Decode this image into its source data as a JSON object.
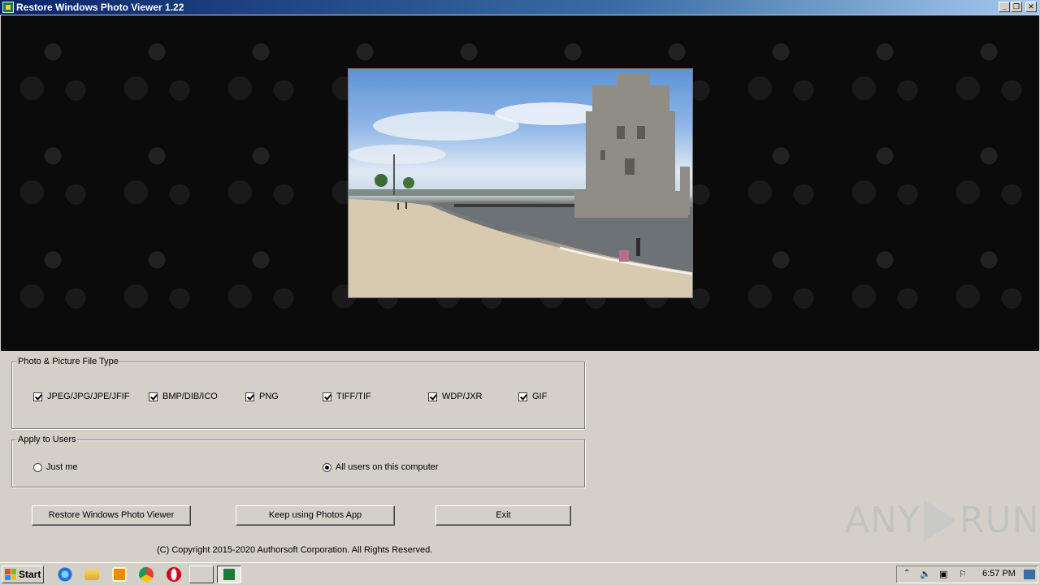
{
  "window": {
    "title": "Restore Windows Photo Viewer 1.22",
    "controls": {
      "minimize": "_",
      "restore": "❐",
      "close": "✕"
    }
  },
  "file_types": {
    "legend": "Photo & Picture File Type",
    "items": [
      {
        "label": "JPEG/JPG/JPE/JFIF",
        "checked": true
      },
      {
        "label": "BMP/DIB/ICO",
        "checked": true
      },
      {
        "label": "PNG",
        "checked": true
      },
      {
        "label": "TIFF/TIF",
        "checked": true
      },
      {
        "label": "WDP/JXR",
        "checked": true
      },
      {
        "label": "GIF",
        "checked": true
      }
    ]
  },
  "users": {
    "legend": "Apply to Users",
    "options": [
      {
        "label": "Just me",
        "selected": false
      },
      {
        "label": "All users on this computer",
        "selected": true
      }
    ]
  },
  "buttons": {
    "restore": "Restore Windows Photo Viewer",
    "keep": "Keep using Photos App",
    "exit": "Exit"
  },
  "copyright": "(C) Copyright 2015-2020 Authorsoft Corporation. All Rights Reserved.",
  "watermark": {
    "left": "ANY",
    "right": "RUN"
  },
  "taskbar": {
    "start_label": "Start",
    "clock": "6:57 PM",
    "quick_launch_icons": [
      "ie-icon",
      "explorer-icon",
      "media-player-icon",
      "chrome-icon",
      "opera-icon"
    ],
    "tray_icons": [
      "chevron-up-icon",
      "volume-icon",
      "network-icon",
      "flag-icon",
      "show-desktop-icon"
    ]
  },
  "colors": {
    "title_start": "#0a246a",
    "title_end": "#a6caf0",
    "face": "#d4d0c8",
    "preview_bg": "#0b0b0b"
  }
}
